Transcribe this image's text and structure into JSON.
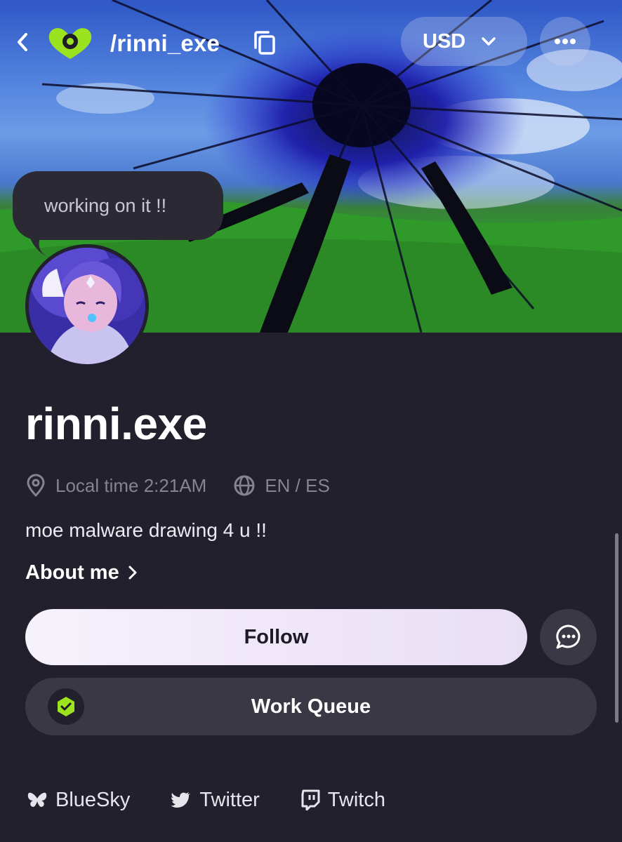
{
  "header": {
    "back_icon": "chevron-left-icon",
    "logo": "brand-logo",
    "handle": "/rinni_exe",
    "copy_icon": "copy-icon",
    "currency": "USD",
    "currency_icon": "chevron-down-icon",
    "more_icon": "more-horizontal-icon"
  },
  "status": {
    "text": "working on it !!"
  },
  "profile": {
    "display_name": "rinni.exe",
    "local_time": "Local time 2:21AM",
    "languages": "EN / ES",
    "bio": "moe malware drawing 4 u !!",
    "about_label": "About me"
  },
  "actions": {
    "follow_label": "Follow",
    "message_icon": "chat-bubble-icon",
    "work_queue_label": "Work Queue"
  },
  "socials": [
    {
      "label": "BlueSky",
      "icon": "butterfly-icon"
    },
    {
      "label": "Twitter",
      "icon": "bird-icon"
    },
    {
      "label": "Twitch",
      "icon": "twitch-icon"
    }
  ],
  "colors": {
    "background": "#21202c",
    "accent_green": "#9be31f",
    "follow_button": "#f1e9f8",
    "surface": "#393844"
  }
}
